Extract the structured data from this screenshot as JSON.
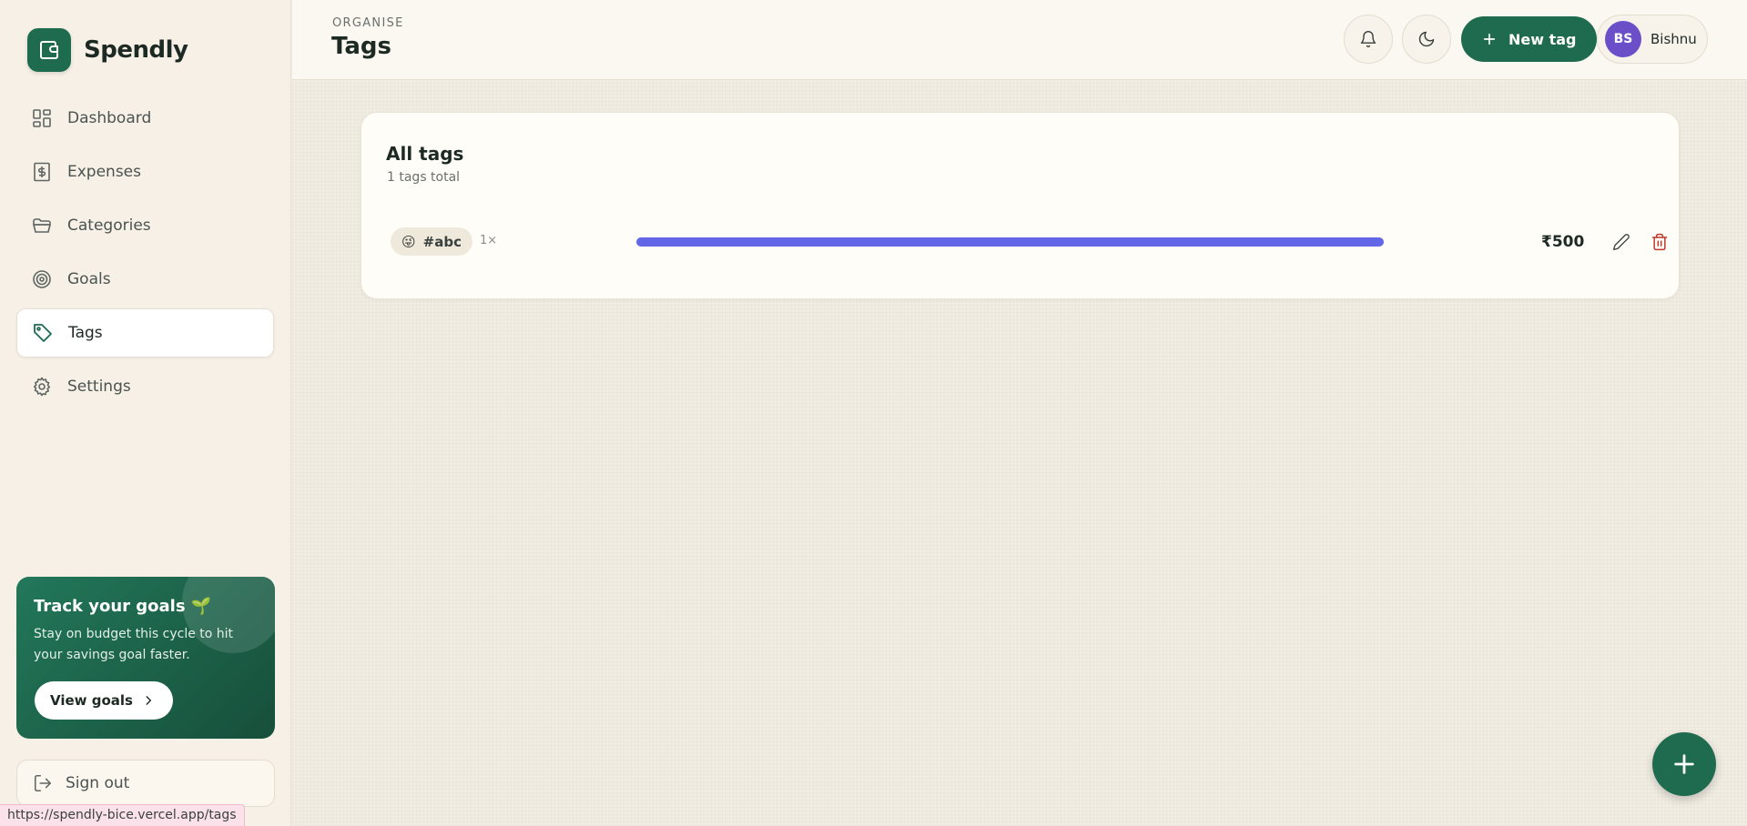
{
  "brand": {
    "name": "Spendly",
    "logo_icon": "wallet-icon",
    "accent": "#1f6b4f"
  },
  "sidebar": {
    "items": [
      {
        "label": "Dashboard",
        "icon": "dashboard-icon",
        "active": false
      },
      {
        "label": "Expenses",
        "icon": "receipt-icon",
        "active": false
      },
      {
        "label": "Categories",
        "icon": "folder-icon",
        "active": false
      },
      {
        "label": "Goals",
        "icon": "target-icon",
        "active": false
      },
      {
        "label": "Tags",
        "icon": "tag-icon",
        "active": true
      },
      {
        "label": "Settings",
        "icon": "gear-icon",
        "active": false
      }
    ],
    "promo": {
      "title": "Track your goals 🌱",
      "text": "Stay on budget this cycle to hit your savings goal faster.",
      "button_label": "View goals"
    },
    "signout_label": "Sign out"
  },
  "header": {
    "eyebrow": "ORGANISE",
    "title": "Tags",
    "new_tag_label": "New tag",
    "user": {
      "initials": "BS",
      "name": "Bishnu",
      "avatar_color": "#6b4fc9"
    }
  },
  "card": {
    "title": "All tags",
    "subtitle": "1 tags total",
    "tags": [
      {
        "emoji": "😜",
        "name": "#abc",
        "count": "1×",
        "amount": "₹500",
        "share": 1.0,
        "color": "#6466e8"
      }
    ]
  },
  "status_bar": {
    "url": "https://spendly-bice.vercel.app/tags"
  }
}
